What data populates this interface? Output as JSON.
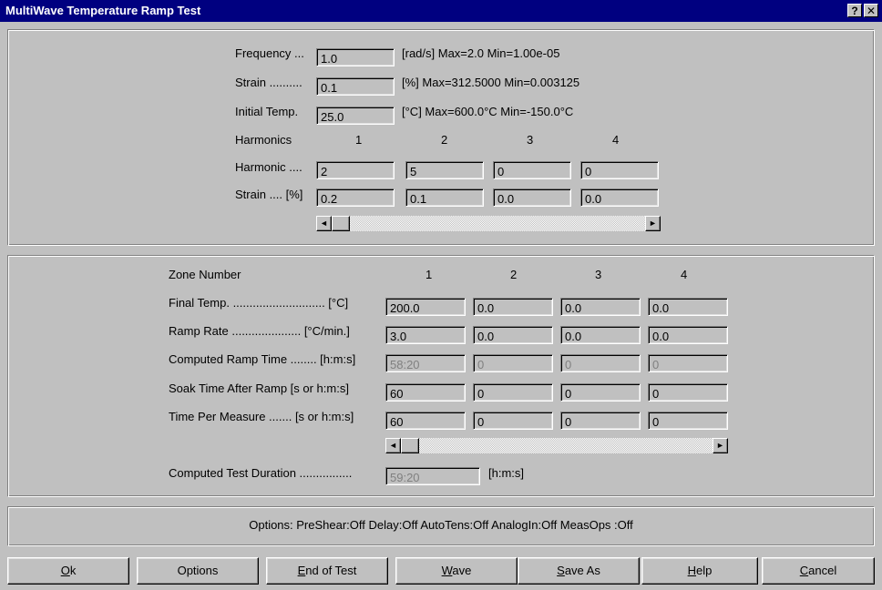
{
  "window": {
    "title": "MultiWave Temperature Ramp Test",
    "help_glyph": "?",
    "close_glyph": "✕"
  },
  "top": {
    "frequency": {
      "label": "Frequency ...",
      "value": "1.0",
      "note": "[rad/s] Max=2.0  Min=1.00e-05"
    },
    "strain": {
      "label": "Strain ..........",
      "value": "0.1",
      "note": "[%] Max=312.5000  Min=0.003125"
    },
    "initial_temp": {
      "label": "Initial Temp.",
      "value": "25.0",
      "note": "[°C] Max=600.0°C  Min=-150.0°C"
    },
    "harmonics_label": "Harmonics",
    "columns": [
      "1",
      "2",
      "3",
      "4"
    ],
    "harmonic_row_label": "Harmonic ....",
    "harmonic_values": [
      "2",
      "5",
      "0",
      "0"
    ],
    "strain_row_label": "Strain .... [%]",
    "strain_values": [
      "0.2",
      "0.1",
      "0.0",
      "0.0"
    ]
  },
  "zones": {
    "header_label": "Zone Number",
    "columns": [
      "1",
      "2",
      "3",
      "4"
    ],
    "rows": [
      {
        "label": "Final Temp.  ............................  [°C]",
        "values": [
          "200.0",
          "0.0",
          "0.0",
          "0.0"
        ],
        "disabled": false
      },
      {
        "label": "Ramp Rate .....................  [°C/min.]",
        "values": [
          "3.0",
          "0.0",
          "0.0",
          "0.0"
        ],
        "disabled": false
      },
      {
        "label": "Computed Ramp Time ........  [h:m:s]",
        "values": [
          "58:20",
          "0",
          "0",
          "0"
        ],
        "disabled": true
      },
      {
        "label": "Soak Time After Ramp   [s or h:m:s]",
        "values": [
          "60",
          "0",
          "0",
          "0"
        ],
        "disabled": false
      },
      {
        "label": "Time Per Measure .......  [s or h:m:s]",
        "values": [
          "60",
          "0",
          "0",
          "0"
        ],
        "disabled": false
      }
    ],
    "duration_label": "Computed Test Duration ................",
    "duration_value": "59:20",
    "duration_unit": "[h:m:s]"
  },
  "options_text": "Options:  PreShear:Off  Delay:Off  AutoTens:Off  AnalogIn:Off  MeasOps :Off",
  "buttons": [
    {
      "mnemonic": "O",
      "rest": "k"
    },
    {
      "mnemonic": "",
      "rest": "Options"
    },
    {
      "mnemonic": "E",
      "rest": "nd of Test"
    },
    {
      "mnemonic": "W",
      "rest": "ave"
    },
    {
      "mnemonic": "S",
      "rest": "ave As"
    },
    {
      "mnemonic": "H",
      "rest": "elp"
    },
    {
      "mnemonic": "C",
      "rest": "ancel"
    }
  ],
  "icons": {
    "scroll_left": "◄",
    "scroll_right": "►"
  }
}
